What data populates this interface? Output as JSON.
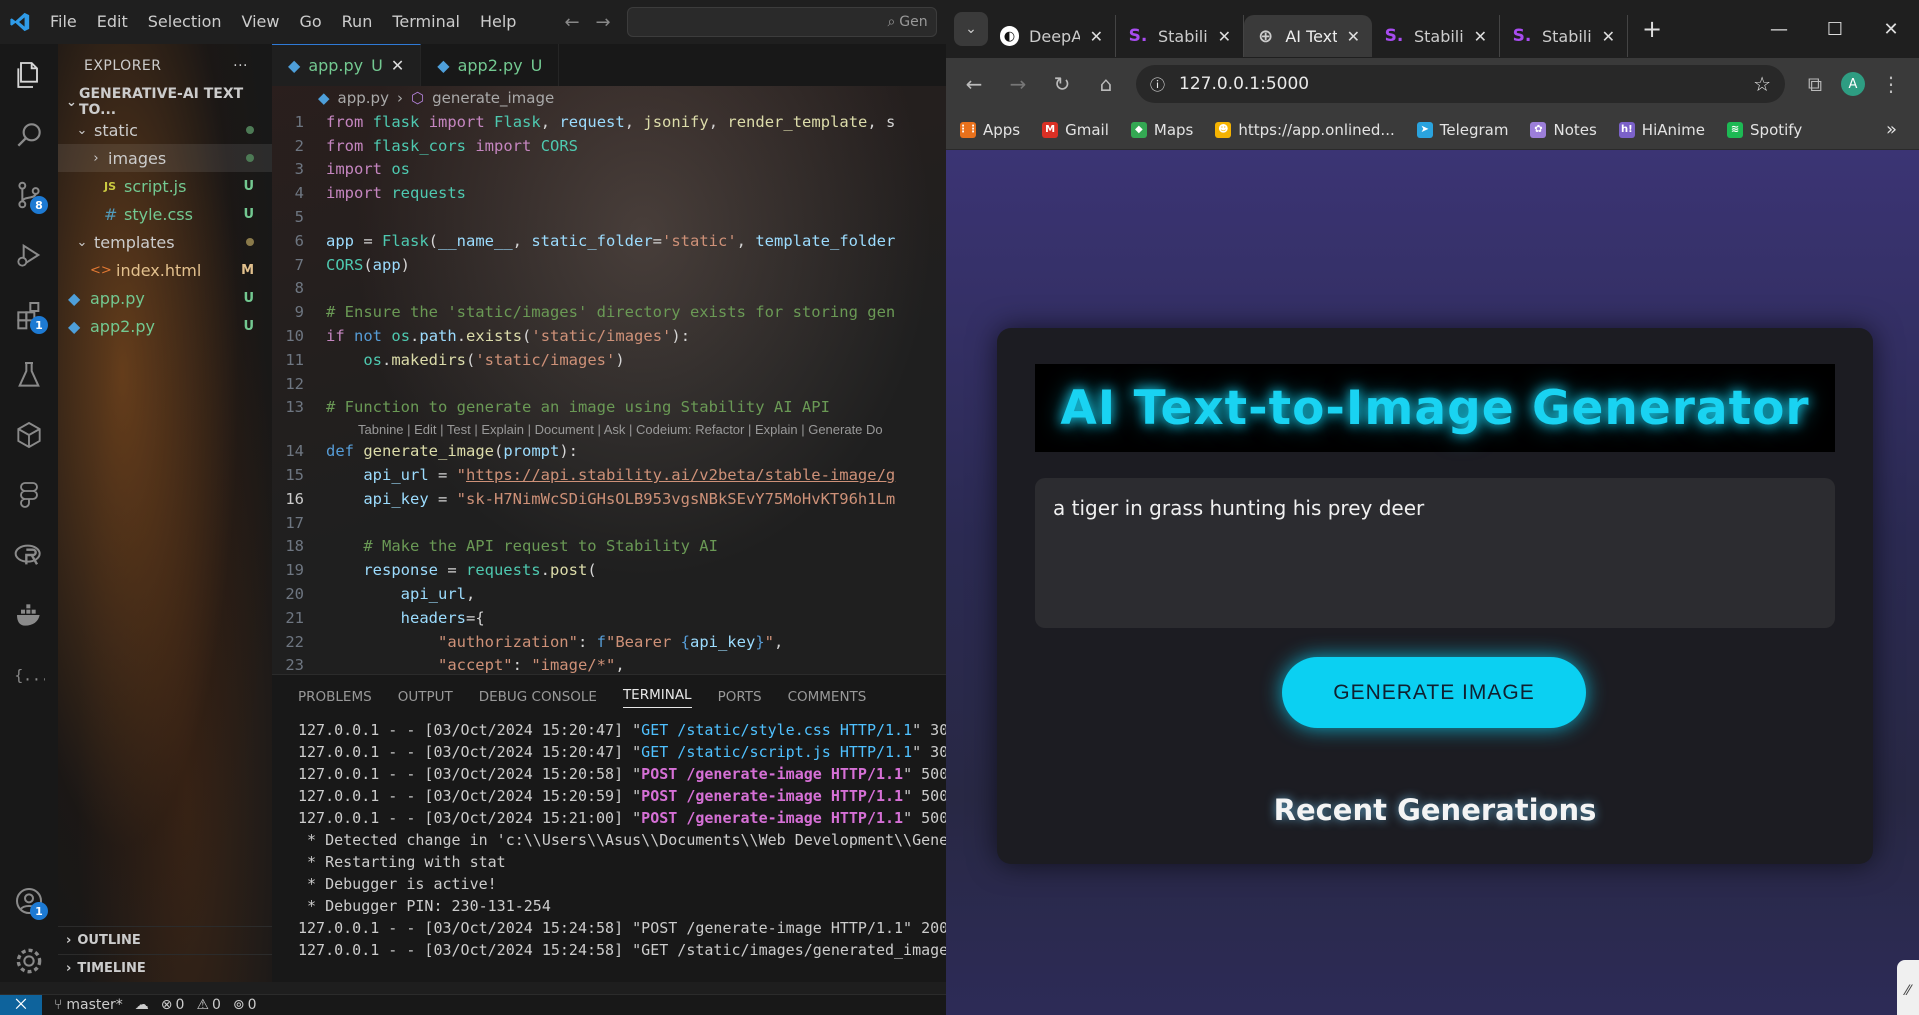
{
  "vscode": {
    "menu": [
      "File",
      "Edit",
      "Selection",
      "View",
      "Go",
      "Run",
      "Terminal",
      "Help"
    ],
    "search_text": "Gen",
    "activity_badges": {
      "source_control": "8",
      "extensions": "1",
      "accounts": "1"
    },
    "explorer": {
      "title": "EXPLORER",
      "root": "GENERATIVE-AI TEXT TO...",
      "items": [
        {
          "label": "static",
          "status": "",
          "type": "folder-open"
        },
        {
          "label": "images",
          "status": "",
          "type": "folder"
        },
        {
          "label": "script.js",
          "status": "U",
          "type": "js"
        },
        {
          "label": "style.css",
          "status": "U",
          "type": "css"
        },
        {
          "label": "templates",
          "status": "",
          "type": "folder-open"
        },
        {
          "label": "index.html",
          "status": "M",
          "type": "html"
        },
        {
          "label": "app.py",
          "status": "U",
          "type": "py"
        },
        {
          "label": "app2.py",
          "status": "U",
          "type": "py"
        }
      ],
      "outline": "OUTLINE",
      "timeline": "TIMELINE"
    },
    "tabs": [
      {
        "label": "app.py",
        "status": "U"
      },
      {
        "label": "app2.py",
        "status": "U"
      }
    ],
    "breadcrumb": {
      "file": "app.py",
      "symbol": "generate_image"
    },
    "lens": "Tabnine | Edit | Test | Explain | Document | Ask | Codeium: Refactor | Explain | Generate Do",
    "panel_tabs": [
      "PROBLEMS",
      "OUTPUT",
      "DEBUG CONSOLE",
      "TERMINAL",
      "PORTS",
      "COMMENTS"
    ],
    "terminal": [
      {
        "pre": "127.0.0.1 - - [03/Oct/2024 15:20:47] \"",
        "req": "GET /static/style.css HTTP/1.1",
        "post": "\" 30",
        "kind": "get"
      },
      {
        "pre": "127.0.0.1 - - [03/Oct/2024 15:20:47] \"",
        "req": "GET /static/script.js HTTP/1.1",
        "post": "\" 30",
        "kind": "get"
      },
      {
        "pre": "127.0.0.1 - - [03/Oct/2024 15:20:58] \"",
        "req": "POST /generate-image HTTP/1.1",
        "post": "\" 500",
        "kind": "err"
      },
      {
        "pre": "127.0.0.1 - - [03/Oct/2024 15:20:59] \"",
        "req": "POST /generate-image HTTP/1.1",
        "post": "\" 500",
        "kind": "err"
      },
      {
        "pre": "127.0.0.1 - - [03/Oct/2024 15:21:00] \"",
        "req": "POST /generate-image HTTP/1.1",
        "post": "\" 500",
        "kind": "err"
      },
      {
        "pre": " * Detected change in 'c:\\\\Users\\\\Asus\\\\Documents\\\\Web Development\\\\Gene",
        "req": "",
        "post": "",
        "kind": "plain"
      },
      {
        "pre": " * Restarting with stat",
        "req": "",
        "post": "",
        "kind": "plain"
      },
      {
        "pre": " * Debugger is active!",
        "req": "",
        "post": "",
        "kind": "plain"
      },
      {
        "pre": " * Debugger PIN: 230-131-254",
        "req": "",
        "post": "",
        "kind": "plain"
      },
      {
        "pre": "127.0.0.1 - - [03/Oct/2024 15:24:58] \"POST /generate-image HTTP/1.1\" 200",
        "req": "",
        "post": "",
        "kind": "plain"
      },
      {
        "pre": "127.0.0.1 - - [03/Oct/2024 15:24:58] \"GET /static/images/generated_image",
        "req": "",
        "post": "",
        "kind": "plain"
      }
    ],
    "status": {
      "branch": "master*",
      "errors": "0",
      "warnings": "0",
      "ports": "0"
    }
  },
  "browser": {
    "tabs": [
      {
        "label": "DeepA",
        "favicon": "deepai-icon",
        "active": false
      },
      {
        "label": "Stabili",
        "favicon": "stability-icon",
        "active": false
      },
      {
        "label": "AI Text",
        "favicon": "globe-icon",
        "active": true
      },
      {
        "label": "Stabili",
        "favicon": "stability-icon",
        "active": false
      },
      {
        "label": "Stabili",
        "favicon": "stability-icon",
        "active": false
      }
    ],
    "url": "127.0.0.1:5000",
    "profile_initial": "A",
    "bookmarks": [
      {
        "label": "Apps",
        "icon": "apps-grid-icon",
        "color": "#e8711c"
      },
      {
        "label": "Gmail",
        "icon": "gmail-icon",
        "color": "#d93025"
      },
      {
        "label": "Maps",
        "icon": "maps-icon",
        "color": "#34a853"
      },
      {
        "label": "https://app.onlined...",
        "icon": "emoji-icon",
        "color": "#f5b301"
      },
      {
        "label": "Telegram",
        "icon": "telegram-icon",
        "color": "#2aa3de"
      },
      {
        "label": "Notes",
        "icon": "notes-icon",
        "color": "#9c7ed9"
      },
      {
        "label": "HiAnime",
        "icon": "hianime-icon",
        "color": "#7b61c9"
      },
      {
        "label": "Spotify",
        "icon": "spotify-icon",
        "color": "#1db954"
      }
    ],
    "page": {
      "title": "AI Text-to-Image Generator",
      "prompt": "a tiger in grass hunting his prey deer",
      "button": "GENERATE IMAGE",
      "recent": "Recent Generations"
    }
  },
  "colors": {
    "accent": "#19d3f2",
    "vscode_blue": "#0e639c"
  }
}
